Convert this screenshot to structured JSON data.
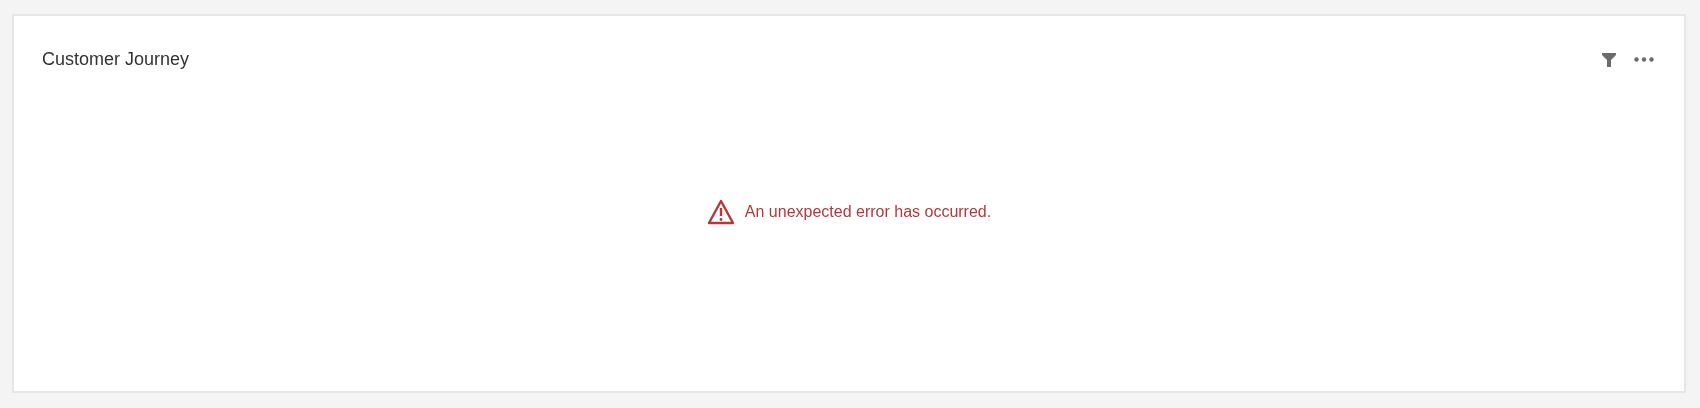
{
  "card": {
    "title": "Customer Journey",
    "error": "An unexpected error has occurred."
  }
}
